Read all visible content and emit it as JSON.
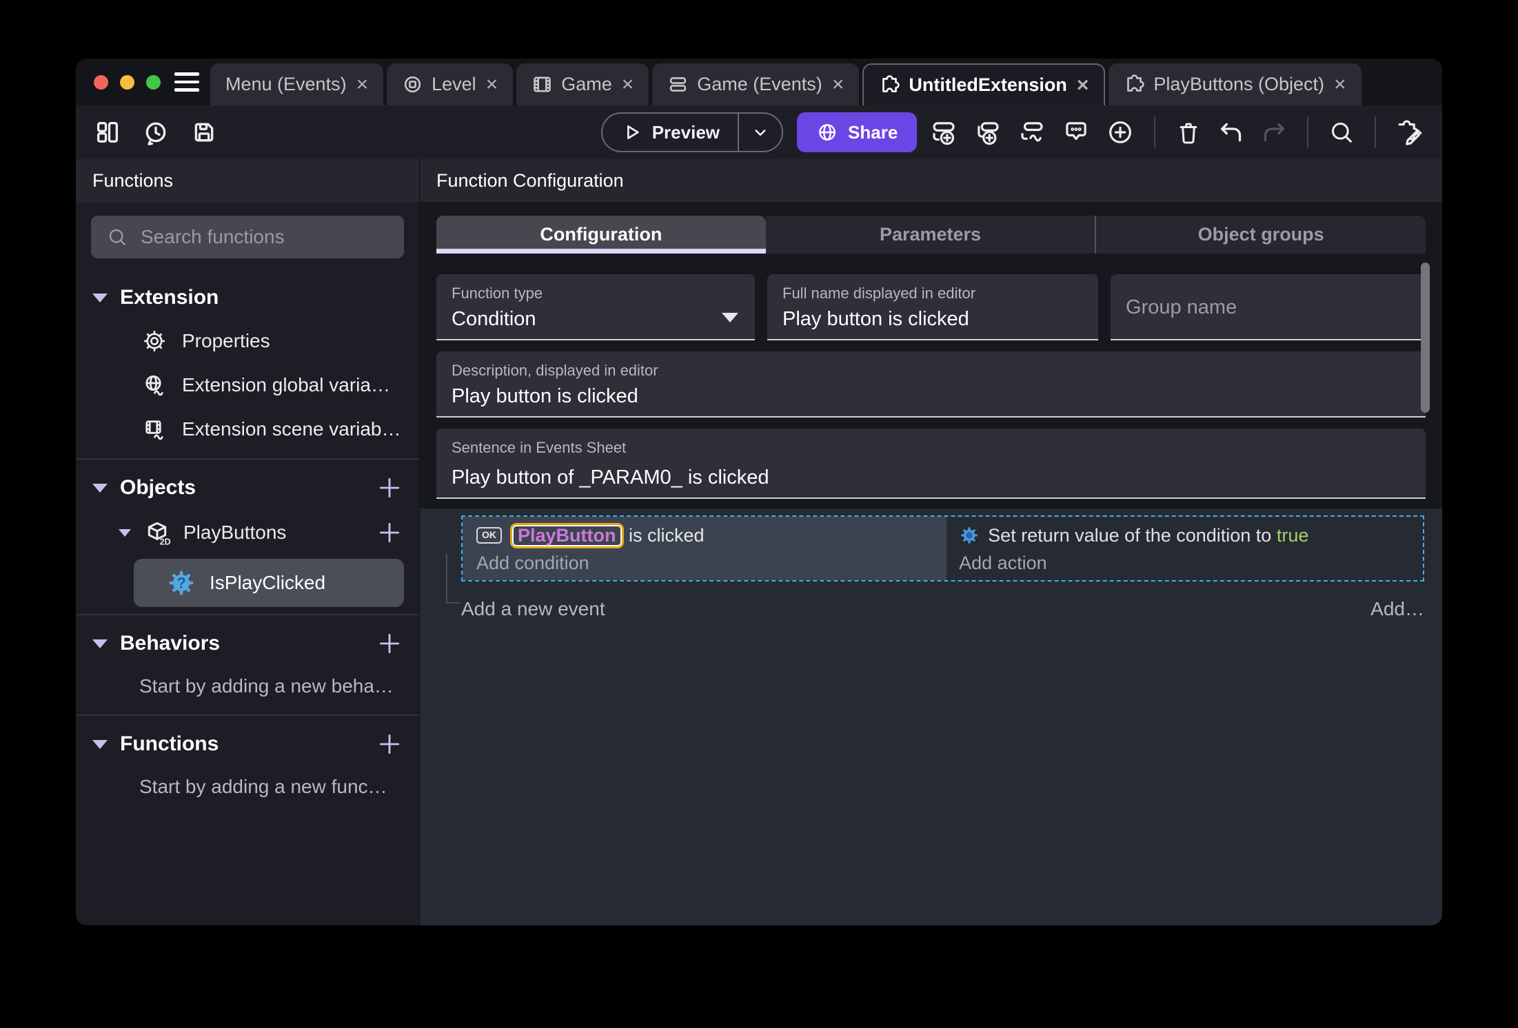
{
  "tabbar": {
    "close_glyph": "×",
    "tabs": [
      {
        "label": "Menu (Events)"
      },
      {
        "label": "Level"
      },
      {
        "label": "Game"
      },
      {
        "label": "Game (Events)"
      },
      {
        "label": "UntitledExtension"
      },
      {
        "label": "PlayButtons (Object)"
      }
    ]
  },
  "toolbar": {
    "preview_label": "Preview",
    "share_label": "Share"
  },
  "sidebar": {
    "title": "Functions",
    "search_placeholder": "Search functions",
    "extension_section": {
      "label": "Extension",
      "items": [
        {
          "label": "Properties"
        },
        {
          "label": "Extension global varia…"
        },
        {
          "label": "Extension scene variab…"
        }
      ]
    },
    "objects_section": {
      "label": "Objects",
      "object": {
        "label": "PlayButtons",
        "badge": "2D"
      },
      "function": {
        "label": "IsPlayClicked",
        "glyph": "?"
      }
    },
    "behaviors_section": {
      "label": "Behaviors",
      "hint": "Start by adding a new beha…"
    },
    "functions_section": {
      "label": "Functions",
      "hint": "Start by adding a new func…"
    }
  },
  "main": {
    "title": "Function Configuration",
    "tabs": [
      {
        "label": "Configuration"
      },
      {
        "label": "Parameters"
      },
      {
        "label": "Object groups"
      }
    ],
    "fields": {
      "function_type": {
        "label": "Function type",
        "value": "Condition"
      },
      "full_name": {
        "label": "Full name displayed in editor",
        "value": "Play button is clicked"
      },
      "group_name": {
        "placeholder": "Group name"
      },
      "description": {
        "label": "Description, displayed in editor",
        "value": "Play button is clicked"
      },
      "sentence": {
        "label": "Sentence in Events Sheet",
        "value": "Play button of _PARAM0_ is clicked"
      }
    },
    "events_sheet": {
      "condition": {
        "badge": "OK",
        "object": "PlayButton",
        "text": " is clicked",
        "add": "Add condition"
      },
      "action": {
        "text": "Set return value of the condition to ",
        "value": "true",
        "add": "Add action"
      },
      "footer": {
        "add_event": "Add a new event",
        "add_more": "Add…"
      }
    }
  },
  "colors": {
    "accent_lavender": "#cbbdf2",
    "share_purple": "#6b46e4",
    "selection_blue": "#3fb0e8",
    "object_name_purple": "#cb7ad7",
    "param_highlight_orange": "#e9a414",
    "boolean_true_green": "#a5d16d",
    "function_icon_blue": "#55a8e0"
  }
}
